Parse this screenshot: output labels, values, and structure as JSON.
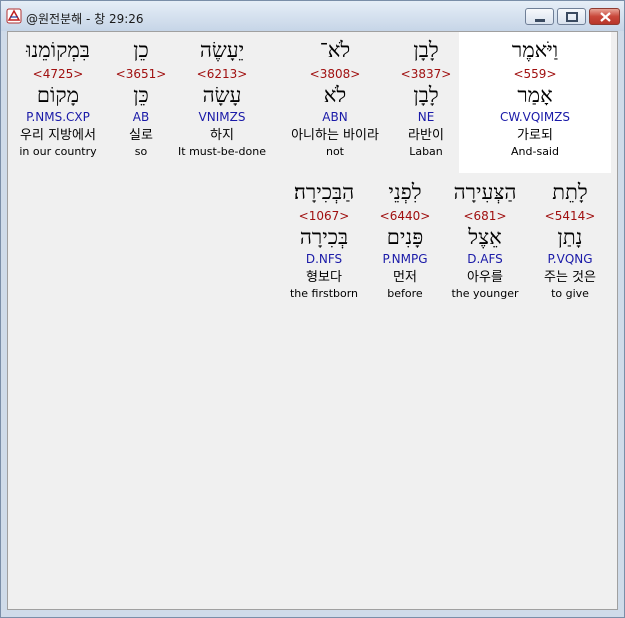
{
  "window": {
    "title": "@원전분해 - 창 29:26"
  },
  "row1": [
    {
      "word": "וַיֹּאמֶר",
      "strong": "<559>",
      "root": "אָמַר",
      "parse": "CW.VQIMZS",
      "korean": "가로되",
      "english": "And-said"
    },
    {
      "word": "לָבָן",
      "strong": "<3837>",
      "root": "לָבָן",
      "parse": "NE",
      "korean": "라반이",
      "english": "Laban"
    },
    {
      "word": "לֹא־",
      "strong": "<3808>",
      "root": "לֹא",
      "parse": "ABN",
      "korean": "아니하는 바이라",
      "english": "not"
    },
    {
      "word": "יֵעָשֶׂה",
      "strong": "<6213>",
      "root": "עָשָׂה",
      "parse": "VNIMZS",
      "korean": "하지",
      "english": "It must-be-done"
    },
    {
      "word": "כֵן",
      "strong": "<3651>",
      "root": "כֵּן",
      "parse": "AB",
      "korean": "실로",
      "english": "so"
    },
    {
      "word": "בִּמְקוֹמֵנוּ",
      "strong": "<4725>",
      "root": "מָקוֹם",
      "parse": "P.NMS.CXP",
      "korean": "우리 지방에서",
      "english": "in our country"
    }
  ],
  "row2": [
    {
      "word": "לָתֵת",
      "strong": "<5414>",
      "root": "נָתַן",
      "parse": "P.VQNG",
      "korean": "주는 것은",
      "english": "to give"
    },
    {
      "word": "הַצְּעִירָה",
      "strong": "<681>",
      "root": "אֵצֶל",
      "parse": "D.AFS",
      "korean": "아우를",
      "english": "the younger"
    },
    {
      "word": "לִפְנֵי",
      "strong": "<6440>",
      "root": "פָּנִים",
      "parse": "P.NMPG",
      "korean": "먼저",
      "english": "before"
    },
    {
      "word": "הַבְּכִירָה׃",
      "strong": "<1067>",
      "root": "בְּכִירָה",
      "parse": "D.NFS",
      "korean": "형보다",
      "english": "the firstborn"
    }
  ],
  "colors": {
    "strong": "#a01010",
    "parse": "#1a1aa8",
    "highlight": "#ffffff"
  }
}
